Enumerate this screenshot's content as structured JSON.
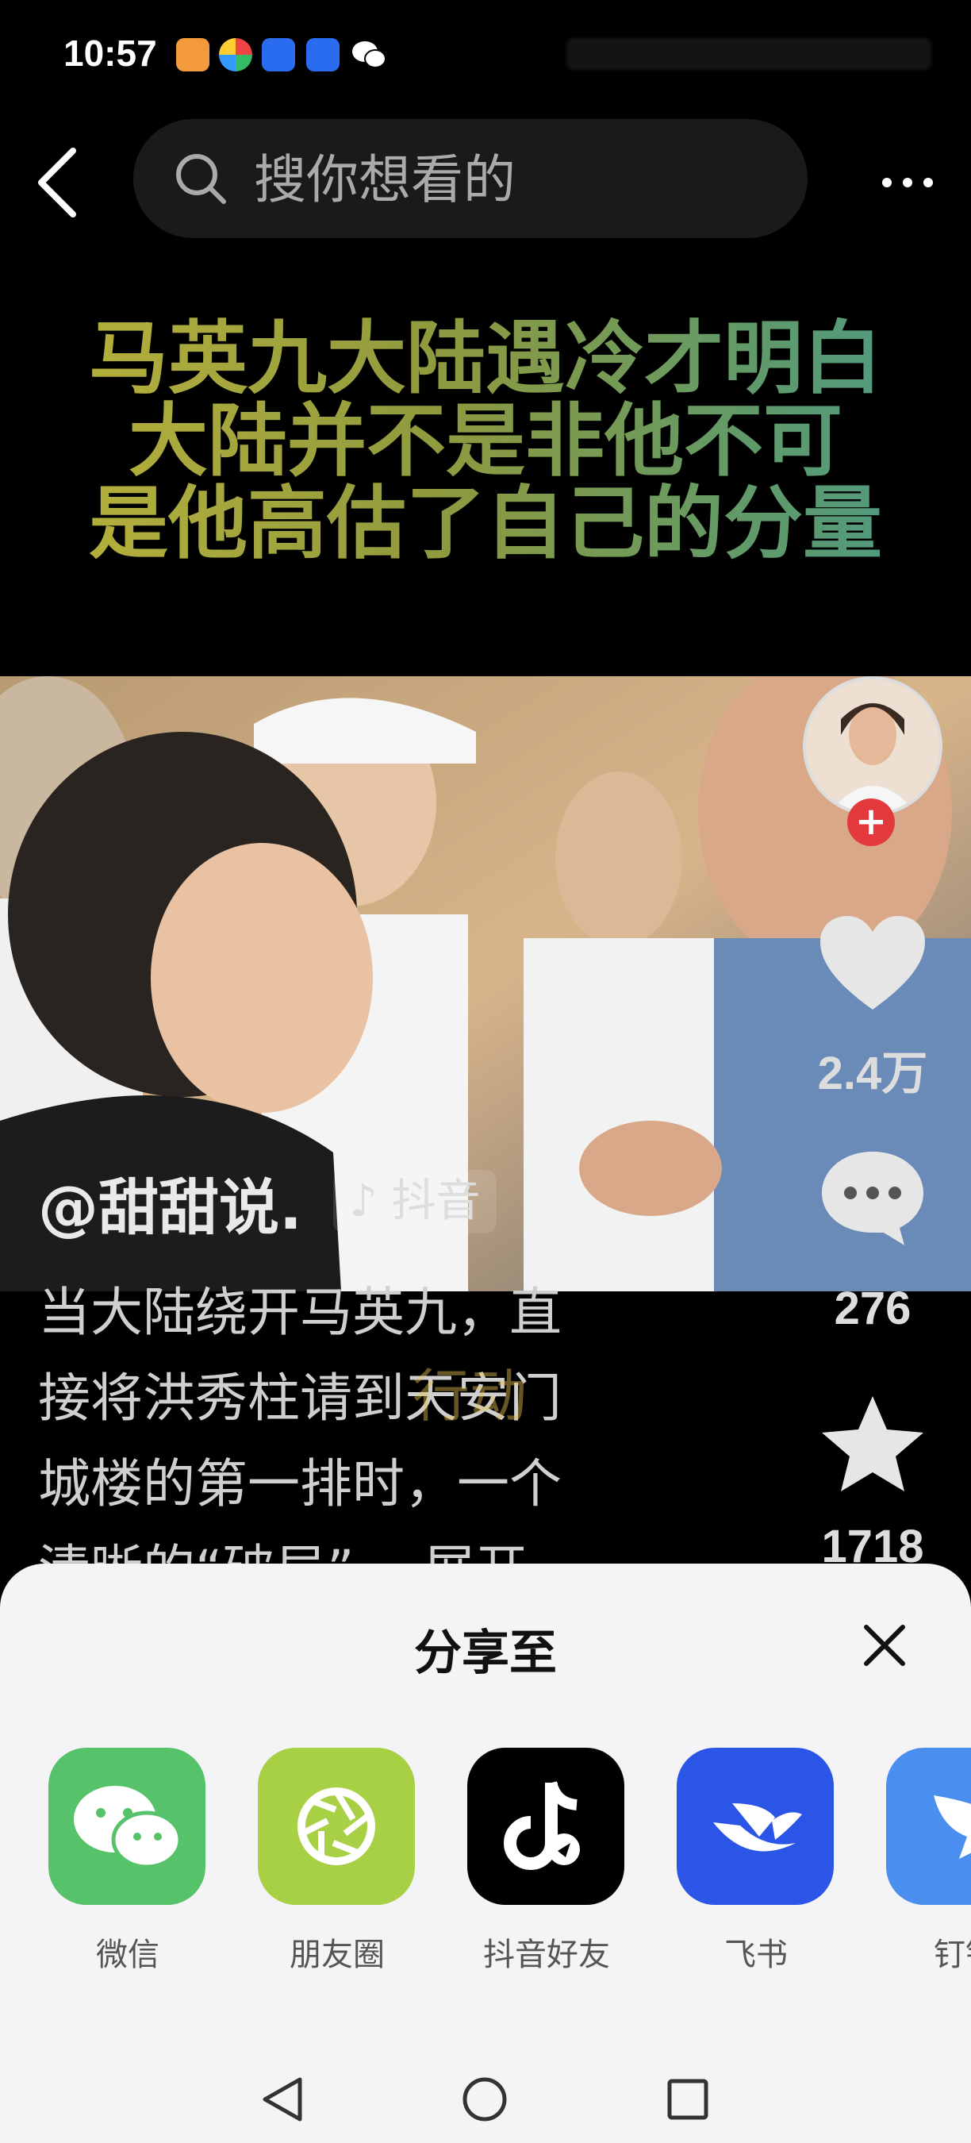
{
  "status_bar": {
    "time": "10:57"
  },
  "search": {
    "placeholder": "搜你想看的"
  },
  "headline": {
    "lines": [
      "马英九大陆遇冷才明白",
      "大陆并不是非他不可",
      "是他高估了自己的分量"
    ]
  },
  "actions": {
    "like_count": "2.4万",
    "comment_count": "276",
    "favorite_count": "1718",
    "follow_symbol": "+"
  },
  "post": {
    "author": "@甜甜说.",
    "platform_tag": "抖音",
    "caption_lines": [
      "当大陆绕开马英九，直",
      "接将洪秀柱请到天安门",
      "城楼的第一排时，一个",
      "清晰的“破局”… 展开"
    ],
    "overlay_text": "行动"
  },
  "share_sheet": {
    "title": "分享至",
    "targets": [
      {
        "label": "微信",
        "icon": "wechat-icon",
        "color": "#56c26a"
      },
      {
        "label": "朋友圈",
        "icon": "moments-icon",
        "color": "#a7d045"
      },
      {
        "label": "抖音好友",
        "icon": "douyin-icon",
        "color": "#000000"
      },
      {
        "label": "飞书",
        "icon": "feishu-icon",
        "color": "#2b55e6"
      },
      {
        "label": "钉钉",
        "icon": "dingtalk-icon",
        "color": "#4a8ff0"
      }
    ]
  },
  "nav": {
    "back": "back-triangle-icon",
    "home": "home-circle-icon",
    "recents": "recents-square-icon"
  }
}
